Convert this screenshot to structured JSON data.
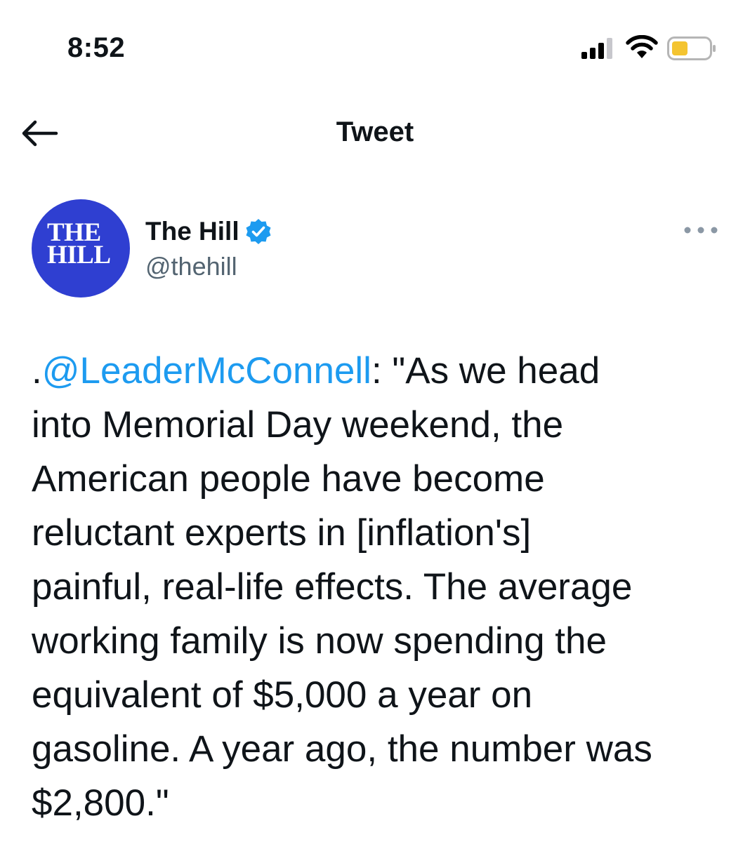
{
  "status_bar": {
    "time": "8:52",
    "icons": [
      "signal-icon",
      "wifi-icon",
      "battery-icon"
    ],
    "battery_color": "#f4c430"
  },
  "nav": {
    "back_icon": "back-arrow-icon",
    "title": "Tweet"
  },
  "author": {
    "avatar_line1": "THE",
    "avatar_line2": "HILL",
    "avatar_color": "#2f3fd1",
    "display_name": "The Hill",
    "verified_icon": "verified-badge-icon",
    "handle": "@thehill",
    "more_icon": "more-options-icon"
  },
  "tweet": {
    "prefix": ".",
    "mention": "@LeaderMcConnell",
    "line1_rest": ": \"As we head",
    "line2": "into Memorial Day weekend, the",
    "line3": "American people have become",
    "line4": "reluctant experts in [inflation's]",
    "line5": "painful, real-life effects. The average",
    "line6": "working family is now spending the",
    "line7": "equivalent of $5,000 a year on",
    "line8": "gasoline. A year ago, the number was",
    "line9": "$2,800.\"",
    "mention_color": "#1d9bf0"
  }
}
